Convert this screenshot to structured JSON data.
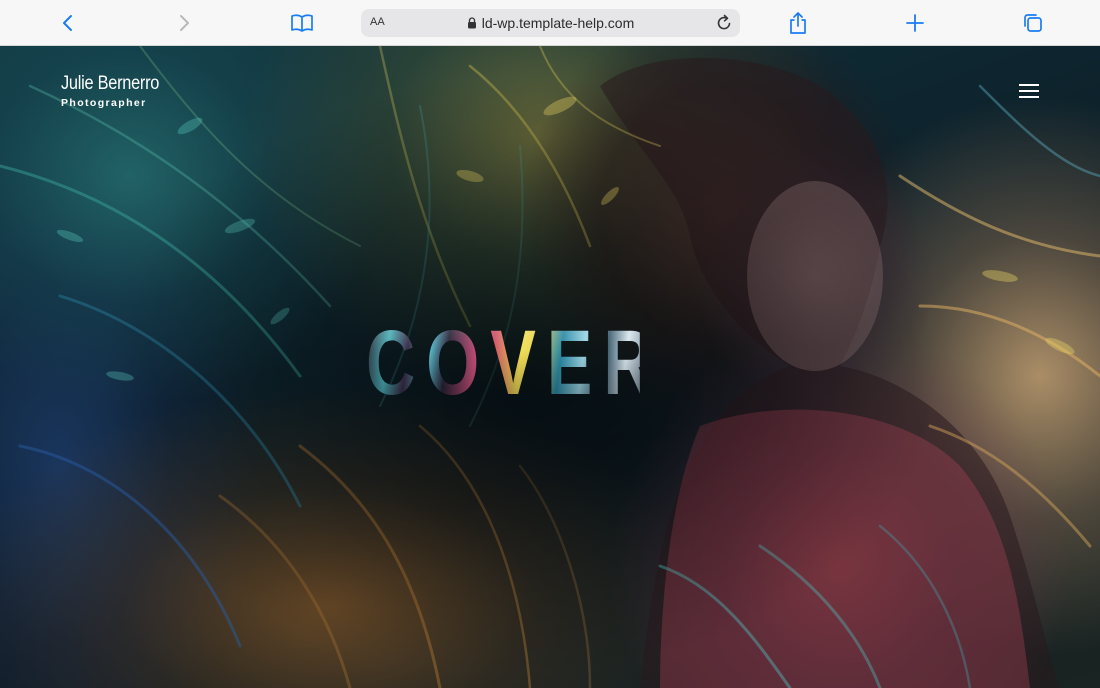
{
  "browser": {
    "address_text_size_label": "AA",
    "url": "ld-wp.template-help.com",
    "accent_color": "#1a7cf5"
  },
  "site": {
    "brand_name": "Julie Bernerro",
    "brand_tagline": "Photographer",
    "hero_title": "COVERS"
  }
}
